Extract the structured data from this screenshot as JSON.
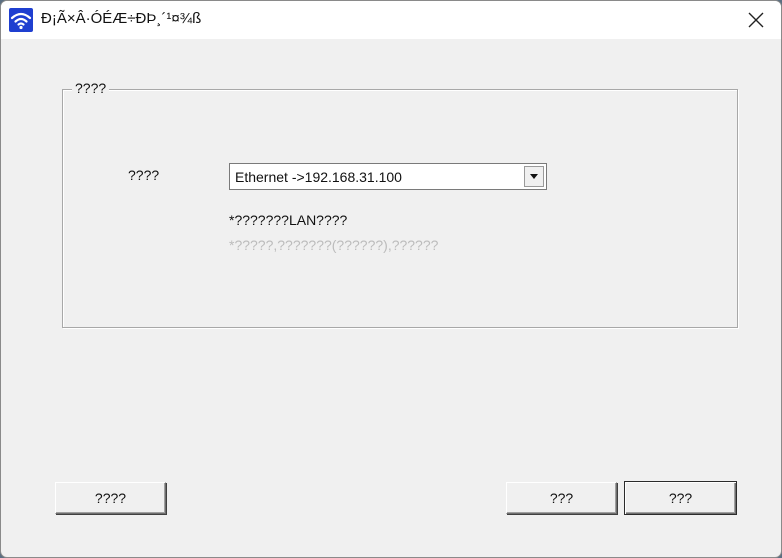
{
  "window": {
    "title": "Ð¡Ã×Â·ÓÉÆ÷ÐÞ¸´¹¤¾ß",
    "close_icon": "close-icon",
    "app_icon": "wifi-icon"
  },
  "group": {
    "title": "????",
    "field_label": "????",
    "select_value": "Ethernet ->192.168.31.100",
    "hint_primary": "*???????LAN????",
    "hint_secondary": "*?????,???????(??????),??????"
  },
  "buttons": {
    "left_label": "????",
    "middle_label": "???",
    "right_label": "???"
  },
  "colors": {
    "app_icon_bg": "#1f3fd0",
    "dialog_bg": "#f0f0f0",
    "disabled_text": "#bcbcbc"
  }
}
